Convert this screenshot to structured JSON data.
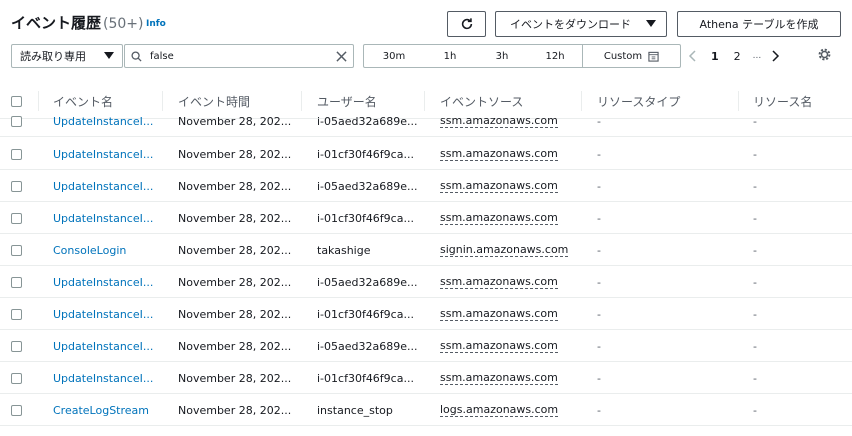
{
  "header": {
    "title": "イベント履歴",
    "count": "(50+)",
    "info": "Info",
    "download_label": "イベントをダウンロード",
    "athena_label": "Athena テーブルを作成"
  },
  "toolbar": {
    "filter_select": "読み取り専用",
    "search_value": "false",
    "time_ranges": [
      "30m",
      "1h",
      "3h",
      "12h",
      "Custom"
    ],
    "pages": [
      "1",
      "2",
      "..."
    ]
  },
  "columns": [
    "イベント名",
    "イベント時間",
    "ユーザー名",
    "イベントソース",
    "リソースタイプ",
    "リソース名"
  ],
  "rows": [
    {
      "event": "UpdateInstanceI...",
      "time": "November 28, 202...",
      "user": "i-05aed32a689e...",
      "source": "ssm.amazonaws.com",
      "rtype": "-",
      "rname": "-"
    },
    {
      "event": "UpdateInstanceI...",
      "time": "November 28, 202...",
      "user": "i-01cf30f46f9ca...",
      "source": "ssm.amazonaws.com",
      "rtype": "-",
      "rname": "-"
    },
    {
      "event": "UpdateInstanceI...",
      "time": "November 28, 202...",
      "user": "i-05aed32a689e...",
      "source": "ssm.amazonaws.com",
      "rtype": "-",
      "rname": "-"
    },
    {
      "event": "UpdateInstanceI...",
      "time": "November 28, 202...",
      "user": "i-01cf30f46f9ca...",
      "source": "ssm.amazonaws.com",
      "rtype": "-",
      "rname": "-"
    },
    {
      "event": "ConsoleLogin",
      "time": "November 28, 202...",
      "user": "takashige",
      "source": "signin.amazonaws.com",
      "rtype": "-",
      "rname": "-"
    },
    {
      "event": "UpdateInstanceI...",
      "time": "November 28, 202...",
      "user": "i-05aed32a689e...",
      "source": "ssm.amazonaws.com",
      "rtype": "-",
      "rname": "-"
    },
    {
      "event": "UpdateInstanceI...",
      "time": "November 28, 202...",
      "user": "i-01cf30f46f9ca...",
      "source": "ssm.amazonaws.com",
      "rtype": "-",
      "rname": "-"
    },
    {
      "event": "UpdateInstanceI...",
      "time": "November 28, 202...",
      "user": "i-05aed32a689e...",
      "source": "ssm.amazonaws.com",
      "rtype": "-",
      "rname": "-"
    },
    {
      "event": "UpdateInstanceI...",
      "time": "November 28, 202...",
      "user": "i-01cf30f46f9ca...",
      "source": "ssm.amazonaws.com",
      "rtype": "-",
      "rname": "-"
    },
    {
      "event": "CreateLogStream",
      "time": "November 28, 202...",
      "user": "instance_stop",
      "source": "logs.amazonaws.com",
      "rtype": "-",
      "rname": "-"
    }
  ],
  "colors": {
    "link": "#0073bb",
    "border": "#eaeded",
    "text": "#16191f"
  }
}
